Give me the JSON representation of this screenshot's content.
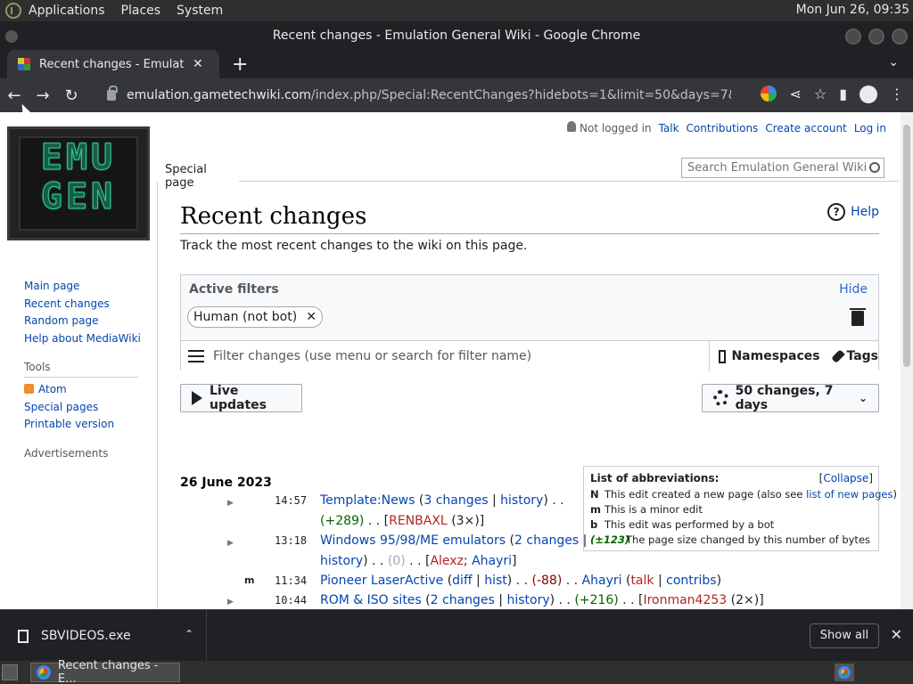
{
  "os_panel": {
    "menus": [
      "Applications",
      "Places",
      "System"
    ],
    "clock": "Mon Jun 26, 09:35"
  },
  "window": {
    "title": "Recent changes - Emulation General Wiki - Google Chrome"
  },
  "browser": {
    "tab_title": "Recent changes - Emulation General Wiki",
    "url_host": "emulation.gametechwiki.com",
    "url_path": "/index.php/Special:RecentChanges?hidebots=1&limit=50&days=7&enhanced..."
  },
  "wiki": {
    "logo_line1": "EMU",
    "logo_line2": "GEN",
    "personal": {
      "not_logged_in": "Not logged in",
      "talk": "Talk",
      "contributions": "Contributions",
      "create_account": "Create account",
      "log_in": "Log in"
    },
    "ns_tab": "Special page",
    "search_placeholder": "Search Emulation General Wiki",
    "sidebar": {
      "nav": [
        "Main page",
        "Recent changes",
        "Random page",
        "Help about MediaWiki"
      ],
      "tools_heading": "Tools",
      "tools": [
        "Atom",
        "Special pages",
        "Printable version"
      ],
      "ads_heading": "Advertisements"
    },
    "page_title": "Recent changes",
    "help": "Help",
    "tagline": "Track the most recent changes to the wiki on this page.",
    "filters": {
      "label": "Active filters",
      "hide": "Hide",
      "chip": "Human (not bot)",
      "input_placeholder": "Filter changes (use menu or search for filter name)",
      "namespaces": "Namespaces",
      "tags": "Tags"
    },
    "live_updates": "Live updates",
    "limit_button": "50 changes, 7 days",
    "abbreviations": {
      "title": "List of abbreviations:",
      "collapse": "Collapse",
      "rows": [
        {
          "key": "N",
          "text": "This edit created a new page (also see ",
          "link": "list of new pages",
          "after": ")"
        },
        {
          "key": "m",
          "text": "This is a minor edit",
          "link": "",
          "after": ""
        },
        {
          "key": "b",
          "text": "This edit was performed by a bot",
          "link": "",
          "after": ""
        },
        {
          "key": "(±123)",
          "text": "The page size changed by this number of bytes",
          "link": "",
          "after": ""
        }
      ]
    },
    "date_heading": "26 June 2023",
    "changes": [
      {
        "time": "14:57",
        "page": "Template:News",
        "changes": "3 changes",
        "history": "history",
        "size": "(+289)",
        "users": "RENBAXL",
        "count": "(3×)"
      },
      {
        "time": "13:18",
        "page": "Windows 95/98/ME emulators",
        "changes": "2 changes",
        "history": "history",
        "size": "(0)",
        "users": "Alexz",
        "users2": "Ahayri"
      },
      {
        "time": "11:34",
        "flag": "m",
        "page": "Pioneer LaserActive",
        "diff": "diff",
        "hist": "hist",
        "size": "(-88)",
        "users": "Ahayri",
        "talk": "talk",
        "contribs": "contribs"
      },
      {
        "time": "10:44",
        "page": "ROM & ISO sites",
        "changes": "2 changes",
        "history": "history",
        "size": "(+216)",
        "users": "Ironman4253",
        "count": "(2×)"
      }
    ]
  },
  "download": {
    "file": "SBVIDEOS.exe",
    "show_all": "Show all"
  },
  "taskbar": {
    "window_button": "Recent changes - E..."
  }
}
